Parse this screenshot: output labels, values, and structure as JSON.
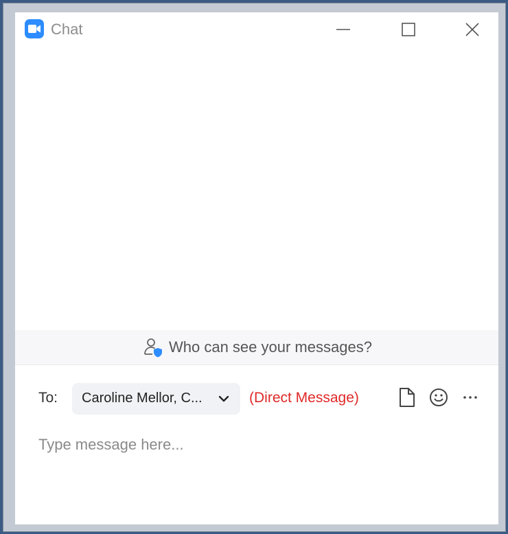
{
  "window": {
    "title": "Chat",
    "app_icon": "zoom-camera-icon",
    "controls": [
      "minimize-icon",
      "maximize-icon",
      "close-icon"
    ]
  },
  "privacy": {
    "icon": "user-shield-icon",
    "text": "Who can see your messages?"
  },
  "compose": {
    "to_label": "To:",
    "recipient": "Caroline Mellor, C...",
    "recipient_icon": "chevron-down-icon",
    "message_type": "(Direct Message)",
    "tools": [
      "file-icon",
      "emoji-icon",
      "more-icon"
    ],
    "message_placeholder": "Type message here...",
    "message_value": ""
  },
  "colors": {
    "accent": "#2d8cff",
    "direct_message": "#e02828",
    "desktop": "#3c5b84",
    "frame": "#c4cad3"
  }
}
